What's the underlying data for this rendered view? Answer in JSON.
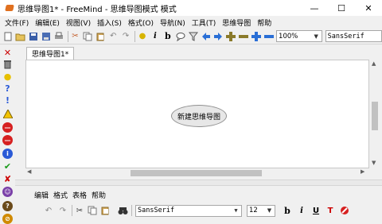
{
  "window": {
    "title": "思维导图1* - FreeMind - 思维导图模式 模式",
    "minimize": "—",
    "maximize": "☐",
    "close": "✕"
  },
  "menubar": [
    "文件(F)",
    "编辑(E)",
    "视图(V)",
    "插入(S)",
    "格式(O)",
    "导航(N)",
    "工具(T)",
    "思维导图",
    "帮助"
  ],
  "toolbar": {
    "zoom": "100%",
    "font": "SansSerif",
    "italic_label": "i",
    "bold_label": "b"
  },
  "tabs": [
    "思维导图1*"
  ],
  "map": {
    "root_node": "新建思维导图"
  },
  "note_editor": {
    "menu": [
      "编辑",
      "格式",
      "表格",
      "帮助"
    ],
    "font": "SansSerif",
    "font_size": "12",
    "bold_label": "b",
    "italic_label": "i",
    "underline_label": "U",
    "text_color_label": "T"
  },
  "colors": {
    "app_icon": "#e0701f",
    "node_fill": "#e7e7e7",
    "arrow_blue": "#2a6fd6",
    "plus_olive": "#8a7a2a"
  }
}
